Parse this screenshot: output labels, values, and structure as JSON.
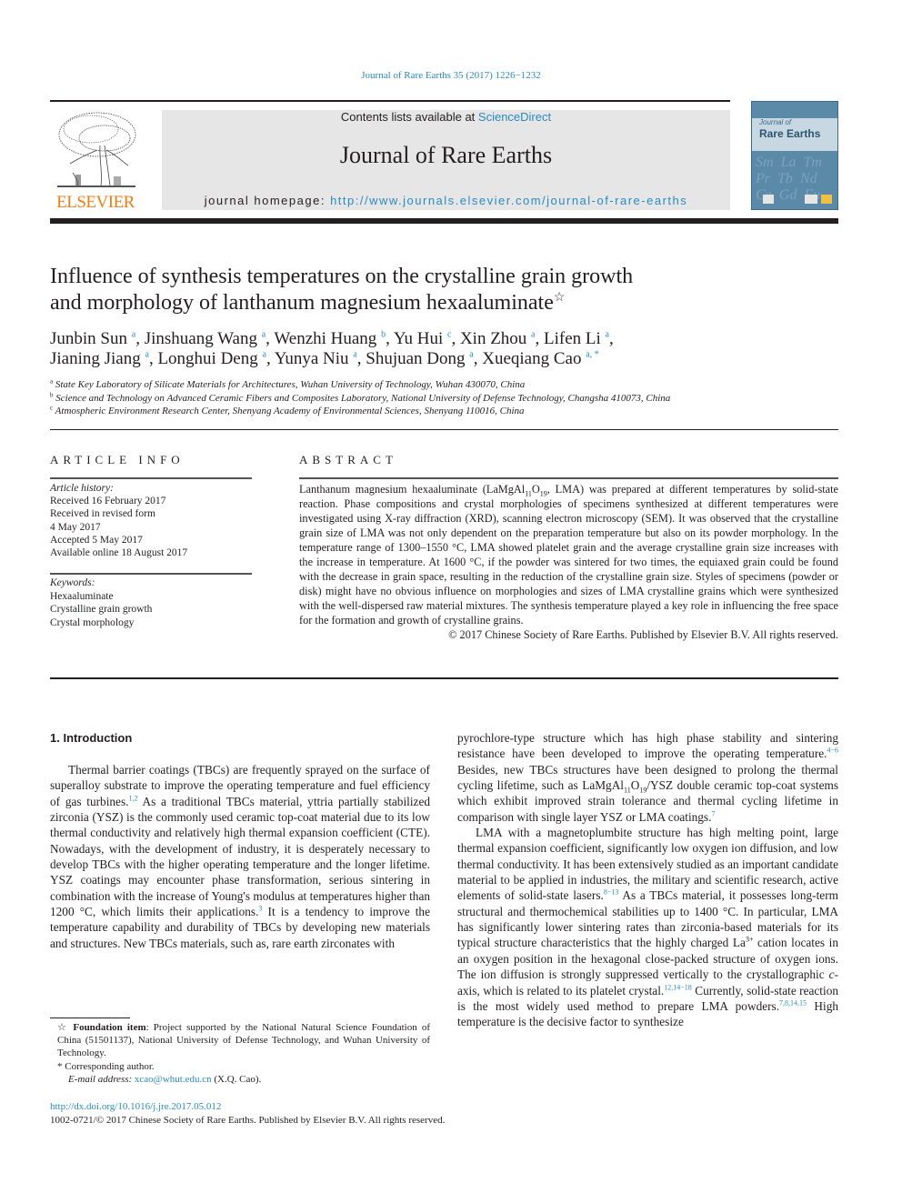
{
  "running_head": "Journal of Rare Earths 35 (2017) 1226−1232",
  "masthead": {
    "contents_prefix": "Contents lists available at ",
    "contents_link": "ScienceDirect",
    "journal_name": "Journal of Rare Earths",
    "homepage_prefix": "journal homepage: ",
    "homepage_url": "http://www.journals.elsevier.com/journal-of-rare-earths",
    "publisher_logo_text": "ELSEVIER",
    "cover": {
      "small_text": "Journal of",
      "title": "Rare Earths",
      "element_symbols": [
        "Sm",
        "La",
        "Tm",
        "Pr",
        "Tb",
        "Nd",
        "Ce",
        "Gd",
        "Eu"
      ]
    }
  },
  "article": {
    "title_line1": "Influence of synthesis temperatures on the crystalline grain growth",
    "title_line2": "and morphology of lanthanum magnesium hexaaluminate",
    "title_marker": "☆",
    "authors": [
      {
        "name": "Junbin Sun",
        "aff": "a"
      },
      {
        "name": "Jinshuang Wang",
        "aff": "a"
      },
      {
        "name": "Wenzhi Huang",
        "aff": "b"
      },
      {
        "name": "Yu Hui",
        "aff": "c"
      },
      {
        "name": "Xin Zhou",
        "aff": "a"
      },
      {
        "name": "Lifen Li",
        "aff": "a"
      },
      {
        "name": "Jianing Jiang",
        "aff": "a"
      },
      {
        "name": "Longhui Deng",
        "aff": "a"
      },
      {
        "name": "Yunya Niu",
        "aff": "a"
      },
      {
        "name": "Shujuan Dong",
        "aff": "a"
      },
      {
        "name": "Xueqiang Cao",
        "aff": "a, *"
      }
    ],
    "affiliations": [
      {
        "mark": "a",
        "text": "State Key Laboratory of Silicate Materials for Architectures, Wuhan University of Technology, Wuhan 430070, China"
      },
      {
        "mark": "b",
        "text": "Science and Technology on Advanced Ceramic Fibers and Composites Laboratory, National University of Defense Technology, Changsha 410073, China"
      },
      {
        "mark": "c",
        "text": "Atmospheric Environment Research Center, Shenyang Academy of Environmental Sciences, Shenyang 110016, China"
      }
    ]
  },
  "article_info": {
    "heading": "ARTICLE INFO",
    "history_label": "Article history:",
    "history": [
      "Received 16 February 2017",
      "Received in revised form",
      "4 May 2017",
      "Accepted 5 May 2017",
      "Available online 18 August 2017"
    ],
    "keywords_label": "Keywords:",
    "keywords": [
      "Hexaaluminate",
      "Crystalline grain growth",
      "Crystal morphology"
    ]
  },
  "abstract": {
    "heading": "ABSTRACT",
    "part1": "Lanthanum magnesium hexaaluminate (LaMgAl",
    "sub1": "11",
    "part2": "O",
    "sub2": "19",
    "part3": ", LMA) was prepared at different temperatures by solid-state reaction. Phase compositions and crystal morphologies of specimens synthesized at different temperatures were investigated using X-ray diffraction (XRD), scanning electron microscopy (SEM). It was observed that the crystalline grain size of LMA was not only dependent on the preparation temperature but also on its powder morphology. In the temperature range of 1300–1550 °C, LMA showed platelet grain and the average crystalline grain size increases with the increase in temperature. At 1600 °C, if the powder was sintered for two times, the equiaxed grain could be found with the decrease in grain space, resulting in the reduction of the crystalline grain size. Styles of specimens (powder or disk) might have no obvious influence on morphologies and sizes of LMA crystalline grains which were synthesized with the well-dispersed raw material mixtures. The synthesis temperature played a key role in influencing the free space for the formation and growth of crystalline grains.",
    "copyright": "© 2017 Chinese Society of Rare Earths. Published by Elsevier B.V. All rights reserved."
  },
  "introduction": {
    "heading": "1.  Introduction",
    "left_p1_a": "Thermal barrier coatings (TBCs) are frequently sprayed on the surface of superalloy substrate to improve the operating temperature and fuel efficiency of gas turbines.",
    "left_p1_ref1": "1,2",
    "left_p1_b": " As a traditional TBCs material, yttria partially stabilized zirconia (YSZ) is the commonly used ceramic top-coat material due to its low thermal conductivity and relatively high thermal expansion coefficient (CTE). Nowadays, with the development of industry, it is desperately necessary to develop TBCs with the higher operating temperature and the longer lifetime. YSZ coatings may encounter phase transformation, serious sintering in combination with the increase of Young's modulus at temperatures higher than 1200 °C, which limits their applications.",
    "left_p1_ref2": "3",
    "left_p1_c": " It is a tendency to improve the temperature capability and durability of TBCs by developing new materials and structures. New TBCs materials, such as, rare earth zirconates with",
    "right_p1_a": "pyrochlore-type structure which has high phase stability and sintering resistance have been developed to improve the operating temperature.",
    "right_p1_ref1": "4−6",
    "right_p1_b": " Besides, new TBCs structures have been designed to prolong the thermal cycling lifetime, such as LaMgAl",
    "right_p1_sub1": "11",
    "right_p1_c": "O",
    "right_p1_sub2": "19",
    "right_p1_d": "/YSZ double ceramic top-coat systems which exhibit improved strain tolerance and thermal cycling lifetime in comparison with single layer YSZ or LMA coatings.",
    "right_p1_ref2": "7",
    "right_p2_a": "LMA with a magnetoplumbite structure has high melting point, large thermal expansion coefficient, significantly low oxygen ion diffusion, and low thermal conductivity. It has been extensively studied as an important candidate material to be applied in industries, the military and scientific research, active elements of solid-state lasers.",
    "right_p2_ref1": "8−13",
    "right_p2_b": " As a TBCs material, it possesses long-term structural and thermochemical stabilities up to 1400 °C. In particular, LMA has significantly lower sintering rates than zirconia-based materials for its typical structure characteristics that the highly charged La",
    "right_p2_sup": "3+",
    "right_p2_c": " cation locates in an oxygen position in the hexagonal close-packed structure of oxygen ions. The ion diffusion is strongly suppressed vertically to the crystallographic ",
    "right_p2_italic": "c",
    "right_p2_d": "-axis, which is related to its platelet crystal.",
    "right_p2_ref2": "12,14−18",
    "right_p2_e": " Currently, solid-state reaction is the most widely used method to prepare LMA powders.",
    "right_p2_ref3": "7,8,14,15",
    "right_p2_f": " High temperature is the decisive factor to synthesize"
  },
  "footnotes": {
    "foundation_marker": "☆",
    "foundation_label": "Foundation item",
    "foundation_text": ": Project supported by the National Natural Science Foundation of China (51501137), National University of Defense Technology, and Wuhan University of Technology.",
    "corresponding_marker": "*",
    "corresponding_text": "Corresponding author.",
    "email_label": "E-mail address: ",
    "email": "xcao@whut.edu.cn",
    "email_suffix": " (X.Q. Cao)."
  },
  "doi": "http://dx.doi.org/10.1016/j.jre.2017.05.012",
  "issn_line": "1002-0721/© 2017 Chinese Society of Rare Earths. Published by Elsevier B.V. All rights reserved.",
  "colors": {
    "link": "#2a8bbd",
    "elsevier_orange": "#f07d14",
    "masthead_gray": "#e6e6e6",
    "cover_blue": "#5a8aa8"
  }
}
